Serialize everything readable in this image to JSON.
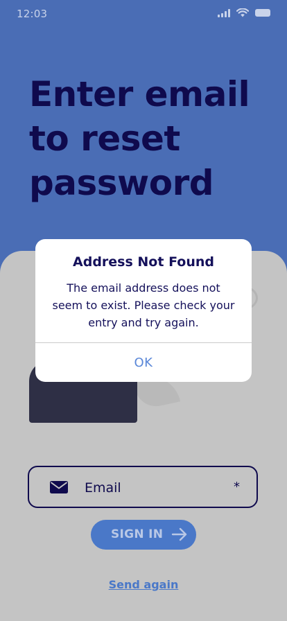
{
  "status_bar": {
    "time": "12:03",
    "icons": [
      "signal-icon",
      "wifi-icon",
      "battery-icon"
    ]
  },
  "headline": "Enter email to reset password",
  "form": {
    "email_placeholder": "Email",
    "required_mark": "*",
    "mail_icon": "envelope-icon",
    "signin_label": "SIGN IN",
    "signin_icon": "arrow-right-icon",
    "send_again_label": "Send again"
  },
  "dialog": {
    "title": "Address Not Found",
    "message": "The email address does not seem to exist. Please check your entry and try again.",
    "ok_label": "OK"
  },
  "colors": {
    "background": "#4a6db5",
    "headline": "#0f0a4d",
    "card": "#c4c4c4",
    "accent": "#4a78c8",
    "dialog_button": "#5a87d8"
  }
}
